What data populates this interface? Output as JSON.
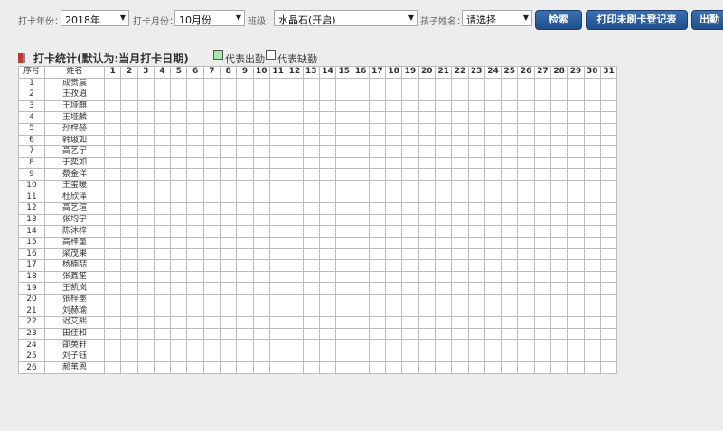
{
  "filters": {
    "year_label": "打卡年份：",
    "year_value": "2018年",
    "month_label": "打卡月份：",
    "month_value": "10月份",
    "class_label": "班级：",
    "class_value": "水晶石(开启)",
    "child_label": "孩子姓名：",
    "child_value": "请选择",
    "dropdown_arrow": "▼"
  },
  "buttons": {
    "search": "检索",
    "print": "打印未刷卡登记表",
    "attendance": "出勤"
  },
  "section": {
    "title": "打卡统计(默认为:当月打卡日期)",
    "legend_present": "代表出勤",
    "legend_absent": "代表缺勤",
    "present_color": "#a6e6a6",
    "accent_color": "#c0392b"
  },
  "table": {
    "headers": {
      "index": "序号",
      "name": "姓名"
    },
    "days": [
      "1",
      "2",
      "3",
      "4",
      "5",
      "6",
      "7",
      "8",
      "9",
      "10",
      "11",
      "12",
      "13",
      "14",
      "15",
      "16",
      "17",
      "18",
      "19",
      "20",
      "21",
      "22",
      "23",
      "24",
      "25",
      "26",
      "27",
      "28",
      "29",
      "30",
      "31"
    ],
    "rows": [
      {
        "index": "1",
        "name": "成贵晨"
      },
      {
        "index": "2",
        "name": "王孜逍"
      },
      {
        "index": "3",
        "name": "王垭麒"
      },
      {
        "index": "4",
        "name": "王垭麟"
      },
      {
        "index": "5",
        "name": "孙梓赫"
      },
      {
        "index": "6",
        "name": "韩琡如"
      },
      {
        "index": "7",
        "name": "高艺宁"
      },
      {
        "index": "8",
        "name": "于奕如"
      },
      {
        "index": "9",
        "name": "蔡金洋"
      },
      {
        "index": "10",
        "name": "王玺暖"
      },
      {
        "index": "11",
        "name": "杜欣泽"
      },
      {
        "index": "12",
        "name": "高艺瑄"
      },
      {
        "index": "13",
        "name": "张均宁"
      },
      {
        "index": "14",
        "name": "陈沐梓"
      },
      {
        "index": "15",
        "name": "高梓童"
      },
      {
        "index": "16",
        "name": "梁茂果"
      },
      {
        "index": "17",
        "name": "杨楠喆"
      },
      {
        "index": "18",
        "name": "张鑫笙"
      },
      {
        "index": "19",
        "name": "王凯岚"
      },
      {
        "index": "20",
        "name": "张梓墨"
      },
      {
        "index": "21",
        "name": "刘赫瑜"
      },
      {
        "index": "22",
        "name": "迟艾熙"
      },
      {
        "index": "23",
        "name": "田佳和"
      },
      {
        "index": "24",
        "name": "邵英轩"
      },
      {
        "index": "25",
        "name": "刘子钰"
      },
      {
        "index": "26",
        "name": "郝苇恩"
      }
    ]
  }
}
